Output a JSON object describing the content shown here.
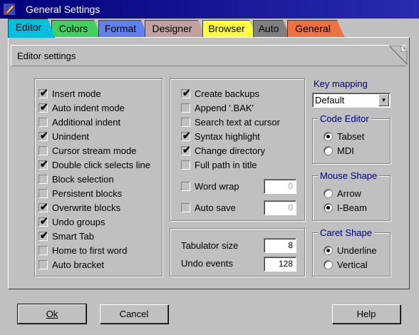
{
  "window": {
    "title": "General Settings",
    "icon": "app-icon-paintbrush"
  },
  "tabs": [
    {
      "label": "Editor",
      "color": "#00c0e0",
      "active": true
    },
    {
      "label": "Colors",
      "color": "#40d060"
    },
    {
      "label": "Format",
      "color": "#6080f0"
    },
    {
      "label": "Designer",
      "color": "#c0a0a0"
    },
    {
      "label": "Browser",
      "color": "#ffff40"
    },
    {
      "label": "Auto",
      "color": "#808080"
    },
    {
      "label": "General",
      "color": "#f07040"
    }
  ],
  "section": {
    "title": "Editor settings"
  },
  "left_options": [
    {
      "label": "Insert mode",
      "checked": true
    },
    {
      "label": "Auto indent mode",
      "checked": true
    },
    {
      "label": "Additional indent",
      "checked": false
    },
    {
      "label": "Unindent",
      "checked": true
    },
    {
      "label": "Cursor stream mode",
      "checked": false
    },
    {
      "label": "Double click selects line",
      "checked": true
    },
    {
      "label": "Block selection",
      "checked": false
    },
    {
      "label": "Persistent blocks",
      "checked": false
    },
    {
      "label": "Overwrite blocks",
      "checked": true
    },
    {
      "label": "Undo groups",
      "checked": true
    },
    {
      "label": "Smart Tab",
      "checked": true
    },
    {
      "label": "Home to first word",
      "checked": false
    },
    {
      "label": "Auto bracket",
      "checked": false
    }
  ],
  "middle_options": [
    {
      "label": "Create backups",
      "checked": true
    },
    {
      "label": "Append '.BAK'",
      "checked": false
    },
    {
      "label": "Search text at cursor",
      "checked": false
    },
    {
      "label": "Syntax highlight",
      "checked": true
    },
    {
      "label": "Change directory",
      "checked": true
    },
    {
      "label": "Full path in title",
      "checked": false
    }
  ],
  "word_wrap": {
    "label": "Word wrap",
    "checked": false,
    "value": "0"
  },
  "auto_save": {
    "label": "Auto save",
    "checked": false,
    "value": "0"
  },
  "tabulator": {
    "label": "Tabulator size",
    "value": "8"
  },
  "undo_events": {
    "label": "Undo events",
    "value": "128"
  },
  "key_mapping": {
    "label": "Key mapping",
    "value": "Default"
  },
  "code_editor": {
    "label": "Code Editor",
    "options": [
      {
        "label": "Tabset",
        "selected": true
      },
      {
        "label": "MDI",
        "selected": false
      }
    ]
  },
  "mouse_shape": {
    "label": "Mouse Shape",
    "options": [
      {
        "label": "Arrow",
        "selected": false
      },
      {
        "label": "I-Beam",
        "selected": true
      }
    ]
  },
  "caret_shape": {
    "label": "Caret Shape",
    "options": [
      {
        "label": "Underline",
        "selected": true
      },
      {
        "label": "Vertical",
        "selected": false
      }
    ]
  },
  "buttons": {
    "ok": "Ok",
    "cancel": "Cancel",
    "help": "Help"
  }
}
